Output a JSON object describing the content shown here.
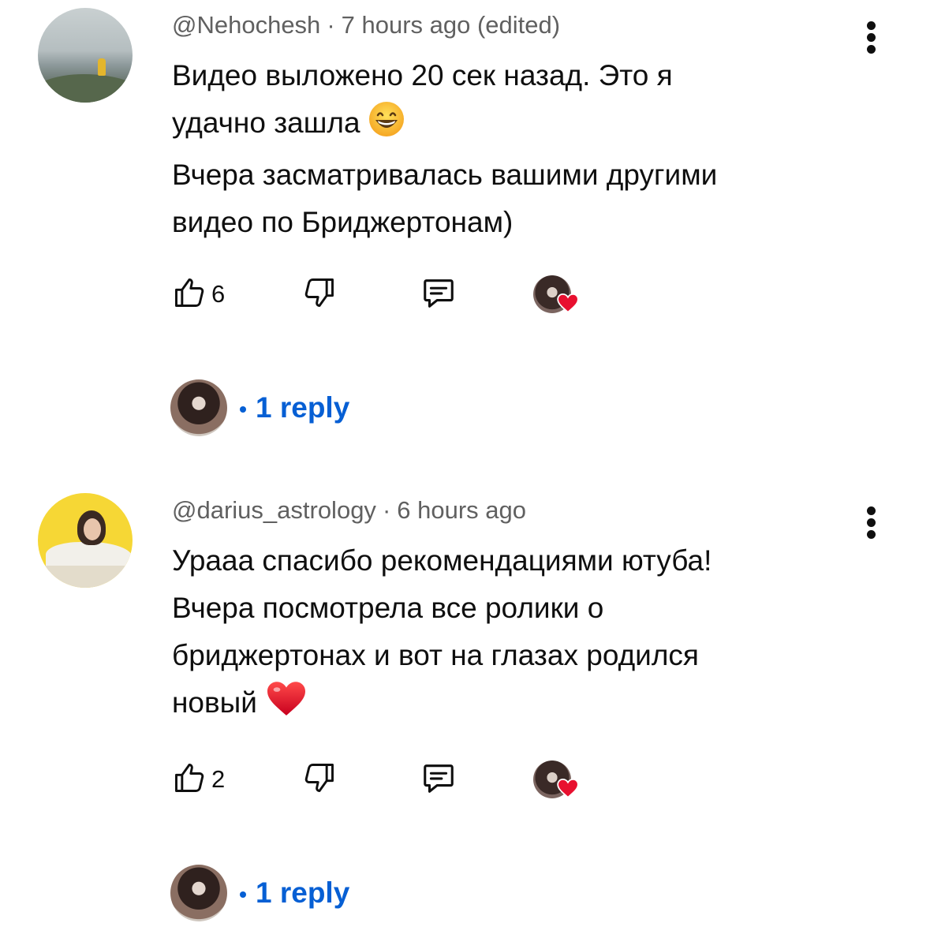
{
  "comments": [
    {
      "author": "@Nehochesh",
      "time": "7 hours ago (edited)",
      "lines": [
        "Видео выложено 20 сек назад. Это я",
        "удачно зашла",
        "Вчера засматривалась вашими другими",
        "видео по Бриджертонам)"
      ],
      "emoji": "grinning-face",
      "likes": "6",
      "replies_label": "1 reply"
    },
    {
      "author": "@darius_astrology",
      "time": "6 hours ago",
      "lines": [
        "Урааа спасибо рекомендациями ютуба!",
        "Вчера посмотрела все ролики о",
        "бриджертонах и вот на глазах родился",
        "новый"
      ],
      "emoji": "red-heart",
      "likes": "2",
      "replies_label": "1 reply"
    }
  ],
  "colors": {
    "meta": "#606060",
    "text": "#0f0f0f",
    "link": "#065fd4",
    "heart": "#e8102f"
  },
  "icons": [
    "like-icon",
    "dislike-icon",
    "reply-icon",
    "more-vert-icon",
    "heart-icon"
  ]
}
